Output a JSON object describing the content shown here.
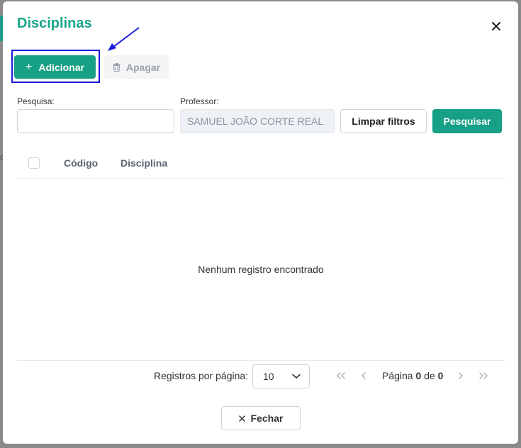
{
  "background": {
    "partial_text": "ci"
  },
  "modal": {
    "title": "Disciplinas",
    "close_icon": "close-icon"
  },
  "toolbar": {
    "add_label": "Adicionar",
    "delete_label": "Apagar"
  },
  "filters": {
    "search_label": "Pesquisa:",
    "search_value": "",
    "professor_label": "Professor:",
    "professor_value": "SAMUEL JOÃO CORTE REAL",
    "clear_label": "Limpar filtros",
    "search_button_label": "Pesquisar"
  },
  "table": {
    "columns": [
      "Código",
      "Disciplina"
    ],
    "empty_message": "Nenhum registro encontrado"
  },
  "pagination": {
    "rows_per_page_label": "Registros por página:",
    "rows_per_page_value": "10",
    "page_prefix": "Página",
    "current_page": "0",
    "of_label": "de",
    "total_pages": "0"
  },
  "footer": {
    "close_label": "Fechar"
  },
  "colors": {
    "accent": "#16a085",
    "highlight": "#1a1adb"
  }
}
